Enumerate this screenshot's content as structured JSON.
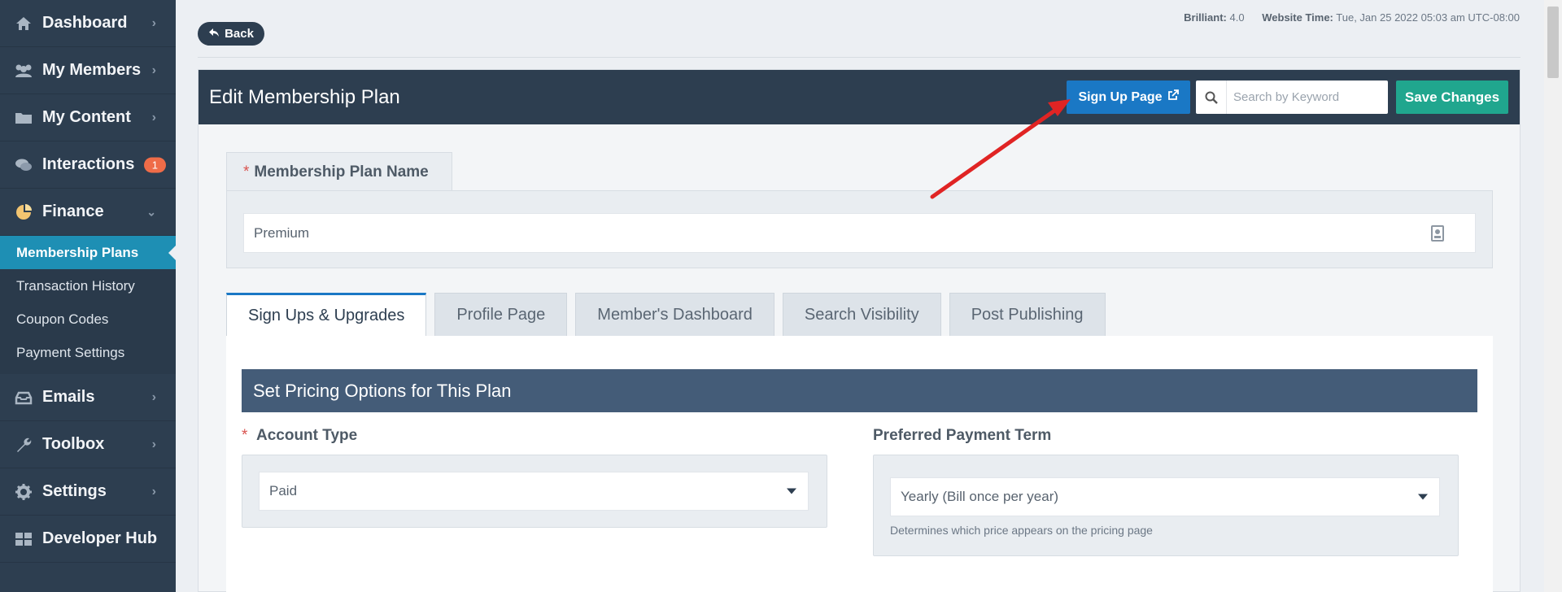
{
  "sidebar": {
    "items": [
      {
        "label": "Dashboard",
        "icon": "home-icon"
      },
      {
        "label": "My Members",
        "icon": "users-icon"
      },
      {
        "label": "My Content",
        "icon": "folder-icon"
      },
      {
        "label": "Interactions",
        "icon": "comments-icon",
        "badge": "1"
      },
      {
        "label": "Finance",
        "icon": "pie-chart-icon"
      }
    ],
    "finance_sub": [
      "Membership Plans",
      "Transaction History",
      "Coupon Codes",
      "Payment Settings"
    ],
    "items_after": [
      {
        "label": "Emails",
        "icon": "inbox-icon"
      },
      {
        "label": "Toolbox",
        "icon": "wrench-icon"
      },
      {
        "label": "Settings",
        "icon": "gear-icon"
      },
      {
        "label": "Developer Hub",
        "icon": "grid-icon"
      }
    ]
  },
  "top": {
    "back_label": "Back",
    "brilliant_label": "Brilliant:",
    "brilliant_value": "4.0",
    "time_label": "Website Time:",
    "time_value": "Tue, Jan 25 2022 05:03 am UTC-08:00"
  },
  "header": {
    "title": "Edit Membership Plan",
    "signup_label": "Sign Up Page",
    "search_placeholder": "Search by Keyword",
    "save_label": "Save Changes"
  },
  "plan_name": {
    "label": "Membership Plan Name",
    "required_mark": "*",
    "value": "Premium"
  },
  "tabs": [
    "Sign Ups & Upgrades",
    "Profile Page",
    "Member's Dashboard",
    "Search Visibility",
    "Post Publishing"
  ],
  "section": {
    "title": "Set Pricing Options for This Plan",
    "account_type_label": "Account Type",
    "account_type_value": "Paid",
    "payment_term_label": "Preferred Payment Term",
    "payment_term_value": "Yearly (Bill once per year)",
    "payment_term_hint": "Determines which price appears on the pricing page"
  },
  "colors": {
    "sidebar_bg": "#2d3e50",
    "active_sub": "#1e8fb4",
    "signup_btn": "#1a78c5",
    "save_btn": "#20a68e",
    "annotation_arrow": "#e02424"
  }
}
